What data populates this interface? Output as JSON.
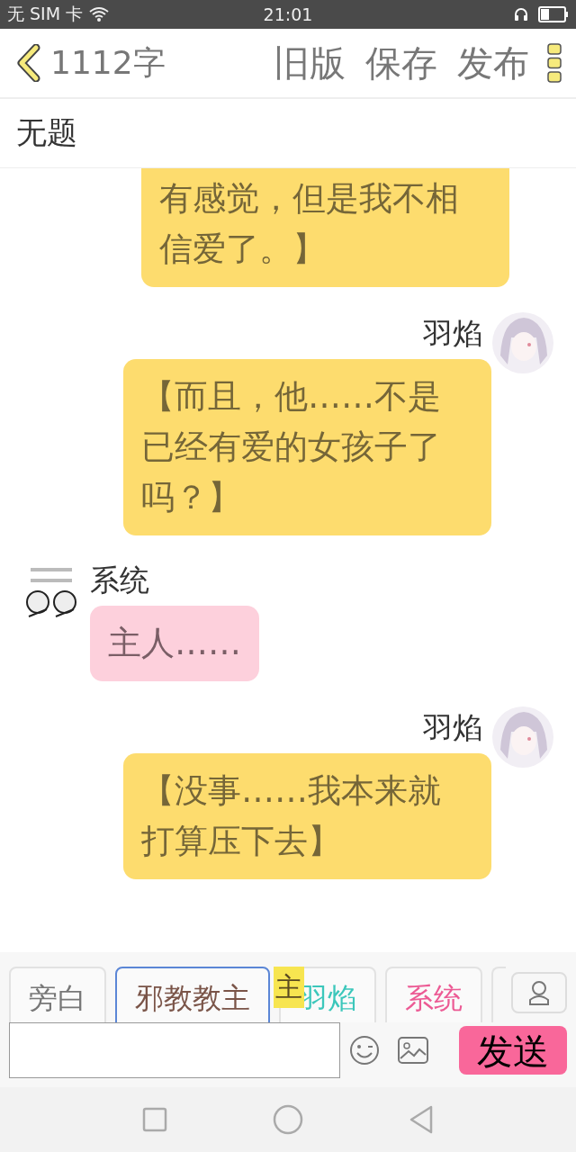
{
  "status_bar": {
    "carrier": "无 SIM 卡",
    "time": "21:01"
  },
  "header": {
    "word_count": "1112字",
    "actions": [
      "旧版",
      "保存",
      "发布"
    ]
  },
  "title": "无题",
  "messages": [
    {
      "kind": "outgoing",
      "color": "#fddc6e",
      "text": "有感觉，但是我不相信爱了。】"
    },
    {
      "kind": "outgoing",
      "color": "#fddc6e",
      "name": "羽焰",
      "text": "【而且，他……不是已经有爱的女孩子了吗？】"
    },
    {
      "kind": "incoming",
      "color": "#fdd0dc",
      "name": "系统",
      "text": "主人……"
    },
    {
      "kind": "outgoing",
      "color": "#fddc6e",
      "name": "羽焰",
      "text": "【没事……我本来就打算压下去】"
    }
  ],
  "roles": [
    {
      "label": "旁白",
      "color": "#777777",
      "selected": false
    },
    {
      "label": "邪教教主",
      "color": "#7a5448",
      "selected": true
    },
    {
      "label": "羽焰",
      "color": "#3cc7bb",
      "selected": false
    },
    {
      "label": "系统",
      "color": "#ec5a94",
      "selected": false
    }
  ],
  "floating_label": "主",
  "send_button": "发送"
}
